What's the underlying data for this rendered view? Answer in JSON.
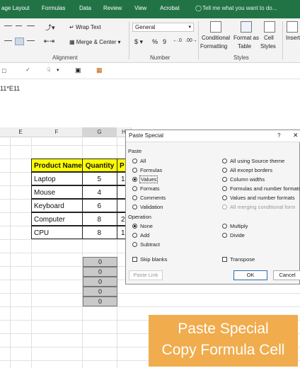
{
  "ribbon_tabs": [
    "age Layout",
    "Formulas",
    "Data",
    "Review",
    "View",
    "Acrobat"
  ],
  "tell_me": "Tell me what you want to do...",
  "ribbon": {
    "wrap_text": "Wrap Text",
    "merge_center": "Merge & Center",
    "alignment_label": "Alignment",
    "number_format": "General",
    "number_label": "Number",
    "currency": "$",
    "percent": "%",
    "comma": "9",
    "conditional_formatting": [
      "Conditional",
      "Formatting"
    ],
    "format_as_table": [
      "Format as",
      "Table"
    ],
    "cell_styles": [
      "Cell",
      "Styles"
    ],
    "styles_label": "Styles",
    "insert": "Insert"
  },
  "formula_fragment": "11*E11",
  "columns": [
    "E",
    "F",
    "G",
    "H"
  ],
  "table": {
    "headers": [
      "Product Name",
      "Quantity",
      "P"
    ],
    "rows": [
      {
        "name": "Laptop",
        "qty": "5",
        "p": "1"
      },
      {
        "name": "Mouse",
        "qty": "4",
        "p": ""
      },
      {
        "name": "Keyboard",
        "qty": "6",
        "p": ""
      },
      {
        "name": "Computer",
        "qty": "8",
        "p": "2"
      },
      {
        "name": "CPU",
        "qty": "8",
        "p": "1"
      }
    ]
  },
  "result_cells": [
    "0",
    "0",
    "0",
    "0",
    "0"
  ],
  "dialog": {
    "title": "Paste Special",
    "help": "?",
    "paste_section": "Paste",
    "paste_left": [
      "All",
      "Formulas",
      "Values",
      "Formats",
      "Comments",
      "Validation"
    ],
    "paste_right": [
      "All using Source theme",
      "All except borders",
      "Column widths",
      "Formulas and number formats",
      "Values and number formats",
      "All merging conditional form"
    ],
    "operation_section": "Operation",
    "op_left": [
      "None",
      "Add",
      "Subtract"
    ],
    "op_right": [
      "Multiply",
      "Divide"
    ],
    "skip_blanks": "Skip blanks",
    "transpose": "Transpose",
    "paste_link": "Paste Link",
    "ok": "OK",
    "cancel": "Cancel"
  },
  "overlay": {
    "line1": "Paste Special",
    "line2": "Copy Formula Cell"
  },
  "colors": {
    "excel_green": "#217346",
    "header_yellow": "#ffff00",
    "overlay_orange": "#f0ac4d"
  }
}
